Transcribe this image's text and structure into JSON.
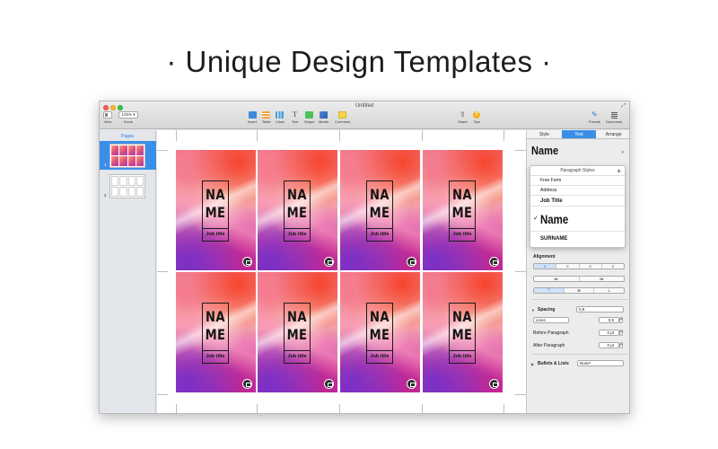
{
  "headline": "· Unique Design Templates ·",
  "window": {
    "title": "Untitled",
    "toolbar": {
      "zoom_value": "125%",
      "view_label": "View",
      "zoom_label": "Zoom",
      "insert_label": "Insert",
      "table_label": "Table",
      "chart_label": "Chart",
      "text_label": "Text",
      "shape_label": "Shape",
      "media_label": "Media",
      "comment_label": "Comment",
      "share_label": "Share",
      "tips_label": "Tips",
      "format_label": "Format",
      "document_label": "Document"
    }
  },
  "sidebar": {
    "title": "Pages",
    "pages": [
      {
        "number": "1"
      },
      {
        "number": "2"
      }
    ]
  },
  "cards": [
    {
      "line1": "NA",
      "line2": "ME",
      "job": "Job title"
    },
    {
      "line1": "NA",
      "line2": "ME",
      "job": "Job title"
    },
    {
      "line1": "NA",
      "line2": "ME",
      "job": "Job title"
    },
    {
      "line1": "NA",
      "line2": "ME",
      "job": "Job title"
    },
    {
      "line1": "NA",
      "line2": "ME",
      "job": "Job title"
    },
    {
      "line1": "NA",
      "line2": "ME",
      "job": "Job title"
    },
    {
      "line1": "NA",
      "line2": "ME",
      "job": "Job title"
    },
    {
      "line1": "NA",
      "line2": "ME",
      "job": "Job title"
    }
  ],
  "inspector": {
    "tabs": [
      "Style",
      "Text",
      "Arrange"
    ],
    "active_tab": "Text",
    "current_style": "Name",
    "paragraph_styles": {
      "header": "Paragraph Styles",
      "items": [
        "Free Form",
        "Address",
        "Job Title",
        "Name",
        "SURNAME"
      ],
      "selected": "Name"
    },
    "alignment": {
      "label": "Alignment",
      "horizontal": [
        "≡",
        "≡",
        "≡",
        "≡"
      ],
      "indent": [
        "◂≡",
        "≡▸"
      ],
      "vertical": [
        "⊤",
        "⊕",
        "⊥"
      ]
    },
    "spacing": {
      "label": "Spacing",
      "value": "0,9",
      "lines_mode": "Lines",
      "lines_value": "0,9",
      "before_label": "Before Paragraph",
      "before_value": "0 pt",
      "after_label": "After Paragraph",
      "after_value": "0 pt"
    },
    "bullets": {
      "label": "Bullets & Lists",
      "value": "None*"
    }
  }
}
